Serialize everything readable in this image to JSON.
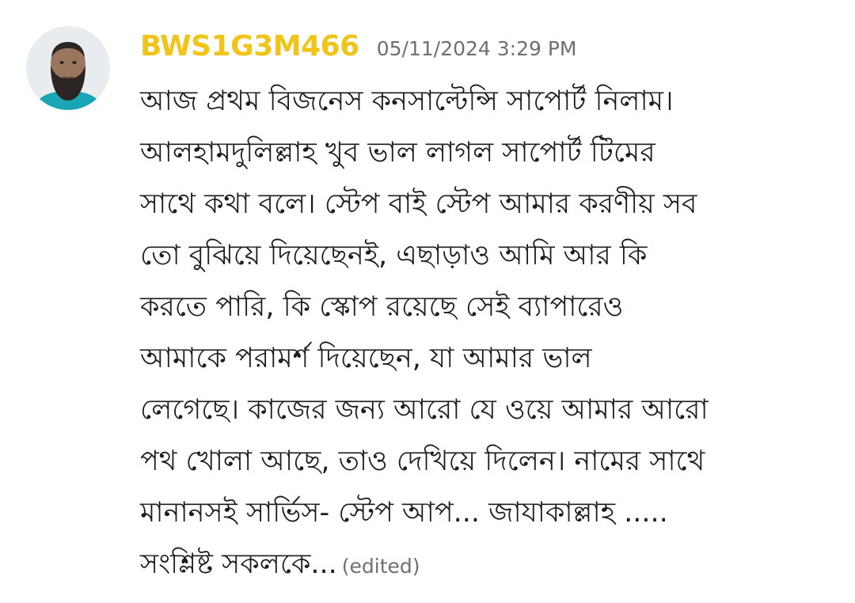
{
  "message": {
    "username": "BWS1G3M466",
    "timestamp": "05/11/2024 3:29 PM",
    "lines": [
      "আজ প্রথম বিজনেস কনসাল্টেন্সি সাপোর্ট নিলাম।",
      "আলহামদুলিল্লাহ খুব ভাল লাগল সাপোর্ট টিমের",
      "সাথে কথা বলে। স্টেপ বাই স্টেপ আমার করণীয় সব",
      "তো বুঝিয়ে দিয়েছেনই, এছাড়াও আমি আর কি",
      "করতে পারি, কি স্কোপ রয়েছে সেই ব্যাপারেও",
      "আমাকে পরামর্শ দিয়েছেন, যা আমার ভাল",
      "লেগেছে। কাজের জন্য আরো যে ওয়ে আমার আরো",
      "পথ খোলা আছে, তাও দেখিয়ে দিলেন। নামের সাথে",
      "মানানসই সার্ভিস- স্টেপ আপ... জাযাকাল্লাহ .....",
      "সংশ্লিষ্ট সকলকে..."
    ],
    "edited_label": "(edited)"
  },
  "colors": {
    "username": "#f0c419",
    "timestamp": "#6b6f76",
    "text": "#1b1c1e",
    "avatar_accent": "#1aa6b7"
  },
  "icons": {
    "avatar": "user-avatar"
  }
}
